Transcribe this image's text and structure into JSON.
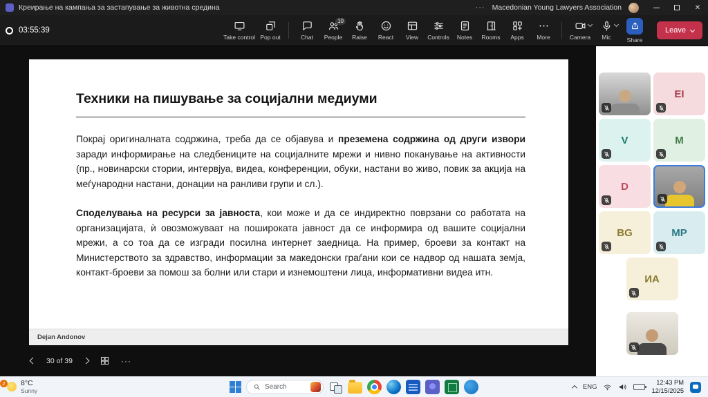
{
  "titlebar": {
    "title": "Креирање на кампања за застапување за животна средина",
    "account": "Macedonian Young Lawyers Association"
  },
  "icons": {
    "ellipsis": "···",
    "close": "✕"
  },
  "toolbar": {
    "timer": "03:55:39",
    "people_badge": "10",
    "buttons": [
      {
        "label": "Take control"
      },
      {
        "label": "Pop out"
      },
      {
        "label": "Chat"
      },
      {
        "label": "People"
      },
      {
        "label": "Raise"
      },
      {
        "label": "React"
      },
      {
        "label": "View"
      },
      {
        "label": "Controls"
      },
      {
        "label": "Notes"
      },
      {
        "label": "Rooms"
      },
      {
        "label": "Apps"
      },
      {
        "label": "More"
      },
      {
        "label": "Camera"
      },
      {
        "label": "Mic"
      },
      {
        "label": "Share"
      },
      {
        "label": "Leave"
      }
    ]
  },
  "slide": {
    "title": "Техники на пишување за социјални медиуми",
    "p1_seg1": "Покрај оригиналната содржина, треба да се објавува и ",
    "p1_seg2": "преземена содржина од други извори",
    "p1_seg3": " заради информирање на следбениците на социјалните мрежи и нивно поканување на активности (пр., новинарски стории, интервјуа, видеа, конференции, обуки, настани во живо, повик за акција на меѓународни настани, донации на ранливи групи и сл.).",
    "p2_seg1": "Споделувања на ресурси за јавноста",
    "p2_seg2": ", кои може и да се индиректно поврзани со работата на организацијата, ѝ овозможуваат на пошироката јавност да се информира од вашите социјални мрежи, а со тоа да се изгради посилна интернет заедница. На пример, броеви за контакт на Министерството за здравство, информации за македонски граѓани кои се надвор од нашата земја, контакт-броеви за помош за болни или стари и изнемоштени лица, информативни видеа итн.",
    "presenter": "Dejan Andonov",
    "page_indicator": "30 of 39"
  },
  "participants": [
    {
      "type": "video",
      "muted": true
    },
    {
      "initials": "EI",
      "bg": "#f5dade",
      "fg": "#a83b4d",
      "muted": true
    },
    {
      "initials": "V",
      "bg": "#dcf2ef",
      "fg": "#1f7a6d",
      "muted": true
    },
    {
      "initials": "M",
      "bg": "#e0f0e3",
      "fg": "#3e7b46",
      "muted": true
    },
    {
      "initials": "D",
      "bg": "#f8dee2",
      "fg": "#c0485a",
      "muted": true
    },
    {
      "type": "video",
      "active_speaker": true,
      "muted": true
    },
    {
      "initials": "BG",
      "bg": "#f6efd9",
      "fg": "#8a7a2f",
      "muted": true
    },
    {
      "initials": "MP",
      "bg": "#d9edf0",
      "fg": "#2b7a85",
      "muted": true
    },
    {
      "initials": "ИА",
      "bg": "#f6efd9",
      "fg": "#8a7a2f",
      "muted": true
    },
    {
      "type": "video",
      "muted": true
    }
  ],
  "taskbar": {
    "weather_badge": "2",
    "weather_temp": "8°C",
    "weather_desc": "Sunny",
    "search_placeholder": "Search",
    "app_icons": [
      "task-view",
      "file-explorer",
      "chrome",
      "edge",
      "word",
      "teams",
      "excel",
      "outlook"
    ],
    "language": "ENG",
    "time": "12:43 PM",
    "date": "12/15/2025"
  },
  "colors": {
    "accent": "#5b5fc7",
    "leave_red": "#c4314b",
    "share_blue": "#2b5fbf",
    "active_border": "#3b7ce0"
  }
}
